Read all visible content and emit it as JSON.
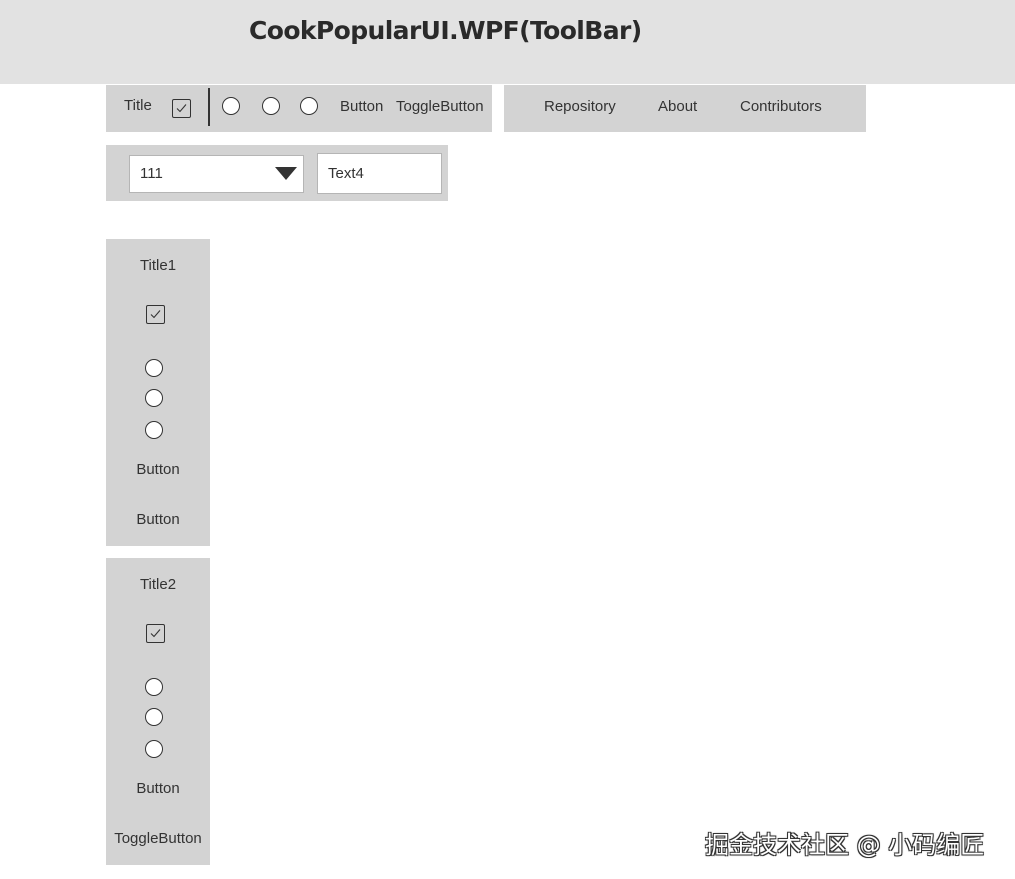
{
  "window": {
    "title": "CookPopularUI.WPF(ToolBar)"
  },
  "toolbar1": {
    "title": "Title",
    "checkbox_checked": true,
    "radio_count": 3,
    "button_label": "Button",
    "toggle_label": "ToggleButton"
  },
  "toolbar2": {
    "items": [
      "Repository",
      "About",
      "Contributors"
    ]
  },
  "toolbar3": {
    "combo_value": "111",
    "text_value": "Text4"
  },
  "vtoolbar1": {
    "title": "Title1",
    "checkbox_checked": true,
    "button1_label": "Button",
    "button2_label": "Button"
  },
  "vtoolbar2": {
    "title": "Title2",
    "checkbox_checked": true,
    "button_label": "Button",
    "toggle_label": "ToggleButton"
  },
  "watermark": "掘金技术社区 @ 小码编匠",
  "colors": {
    "titlebar_bg": "#e2e2e2",
    "toolbar_bg": "#d3d3d3",
    "text": "#333333"
  }
}
